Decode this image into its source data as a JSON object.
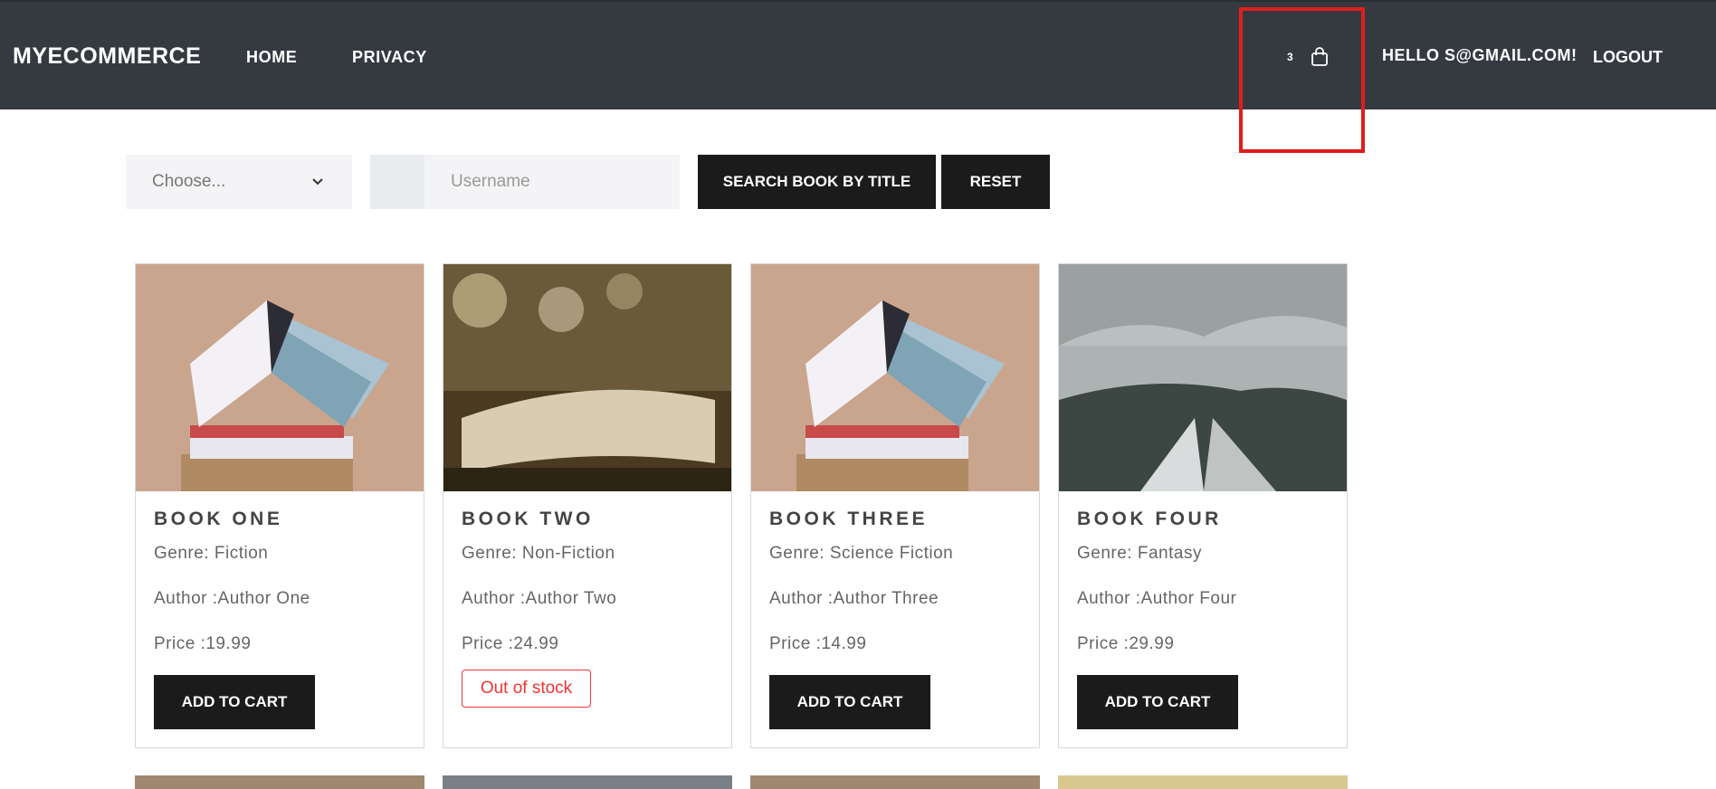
{
  "navbar": {
    "brand": "MYECOMMERCE",
    "links": [
      "HOME",
      "PRIVACY"
    ],
    "cart_count": "3",
    "cart_icon": "shopping-bag-icon",
    "greeting": "HELLO S@GMAIL.COM!",
    "logout": "LOGOUT",
    "background": "#343a40"
  },
  "search": {
    "select_value": "Choose...",
    "input_placeholder": "Username",
    "search_button": "SEARCH BOOK BY TITLE",
    "reset_button": "RESET"
  },
  "books": [
    {
      "title": "BOOK ONE",
      "genre": "Genre: Fiction",
      "author": "Author :Author One",
      "price": "Price :19.99",
      "action": "ADD TO CART"
    },
    {
      "title": "BOOK TWO",
      "genre": "Genre: Non-Fiction",
      "author": "Author :Author Two",
      "price": "Price :24.99",
      "status": "Out of stock"
    },
    {
      "title": "BOOK THREE",
      "genre": "Genre: Science Fiction",
      "author": "Author :Author Three",
      "price": "Price :14.99",
      "action": "ADD TO CART"
    },
    {
      "title": "BOOK FOUR",
      "genre": "Genre: Fantasy",
      "author": "Author :Author Four",
      "price": "Price :29.99",
      "action": "ADD TO CART"
    }
  ],
  "colors": {
    "button_dark": "#1b1b1b",
    "out_of_stock": "#e33333",
    "highlight": "#e11d1d"
  }
}
